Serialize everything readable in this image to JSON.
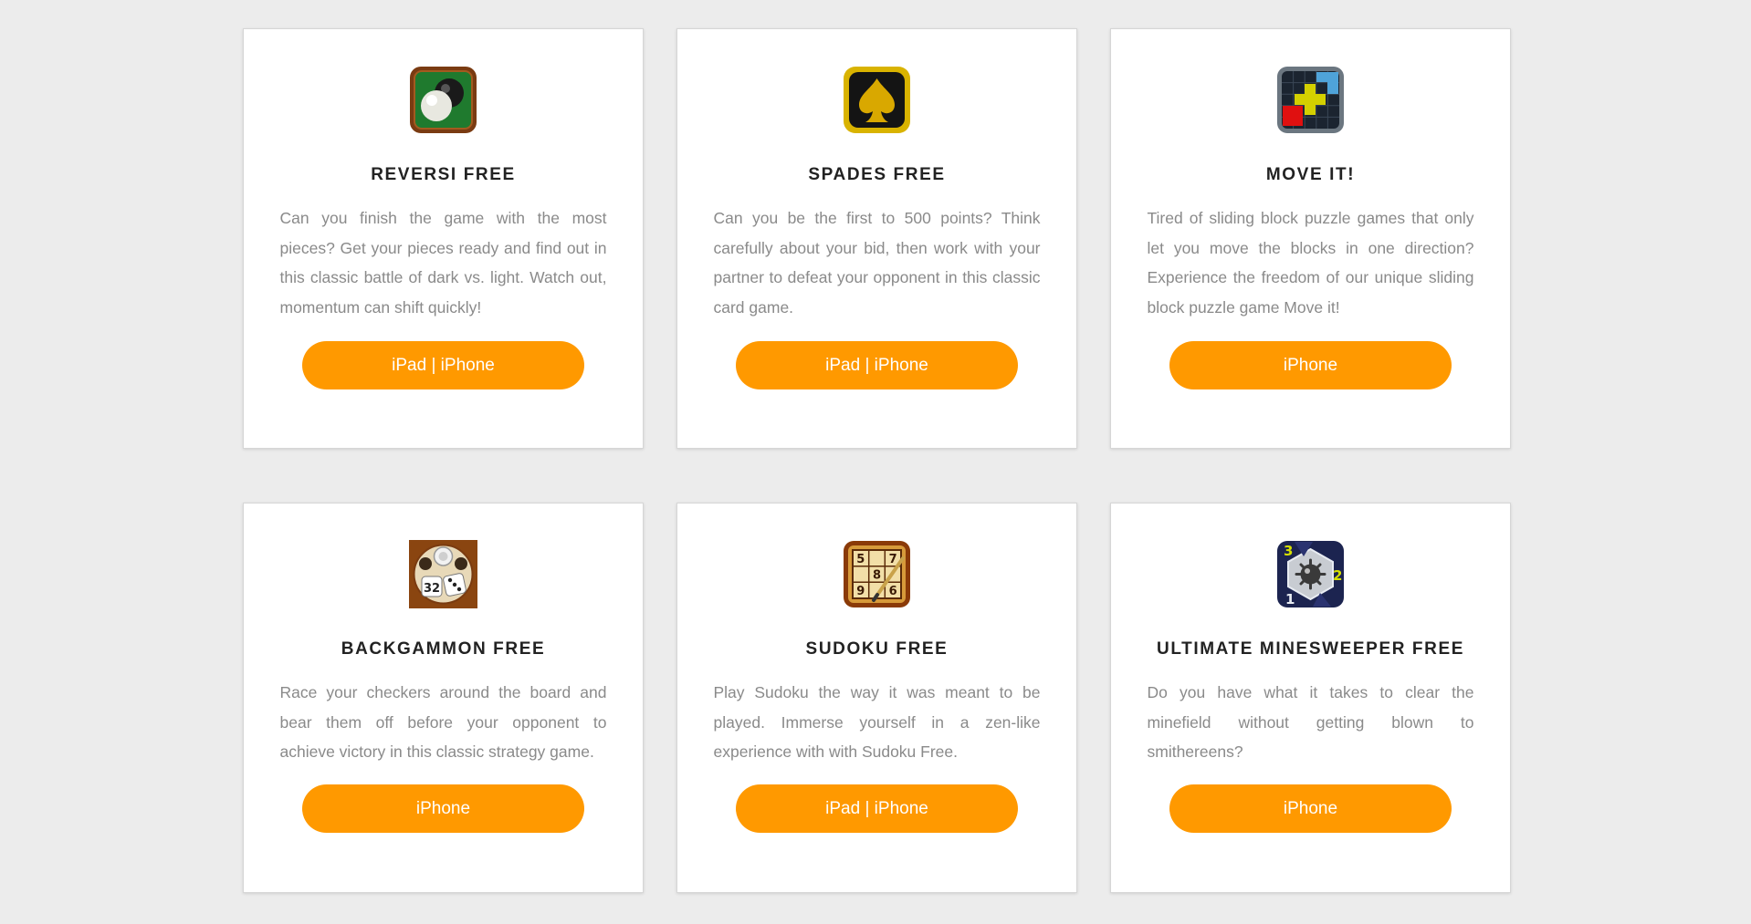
{
  "colors": {
    "background": "#ececec",
    "card": "#ffffff",
    "button": "#ff9900",
    "title": "#222222",
    "description": "#8a8a8a"
  },
  "games": [
    {
      "icon": "reversi-icon",
      "title": "REVERSI FREE",
      "description": "Can you finish the game with the most pieces? Get your pieces ready and find out in this classic battle of dark vs. light. Watch out, momentum can shift quickly!",
      "button": "iPad | iPhone"
    },
    {
      "icon": "spades-icon",
      "title": "SPADES FREE",
      "description": "Can you be the first to 500 points? Think carefully about your bid, then work with your partner to defeat your opponent in this classic card game.",
      "button": "iPad | iPhone"
    },
    {
      "icon": "move-it-icon",
      "title": "MOVE IT!",
      "description": "Tired of sliding block puzzle games that only let you move the blocks in one direction? Experience the freedom of our unique sliding block puzzle game Move it!",
      "button": "iPhone"
    },
    {
      "icon": "backgammon-icon",
      "title": "BACKGAMMON FREE",
      "description": "Race your checkers around the board and bear them off before your opponent to achieve victory in this classic strategy game.",
      "button": "iPhone",
      "icon_text": "32"
    },
    {
      "icon": "sudoku-icon",
      "title": "SUDOKU FREE",
      "description": "Play Sudoku the way it was meant to be played. Immerse yourself in a zen-like experience with with Sudoku Free.",
      "button": "iPad | iPhone",
      "icon_text": [
        "5",
        "7",
        "8",
        "9",
        "6"
      ]
    },
    {
      "icon": "minesweeper-icon",
      "title": "ULTIMATE MINESWEEPER FREE",
      "description": "Do you have what it takes to clear the minefield without getting blown to smithereens?",
      "button": "iPhone",
      "icon_text": [
        "3",
        "2",
        "1"
      ]
    }
  ]
}
